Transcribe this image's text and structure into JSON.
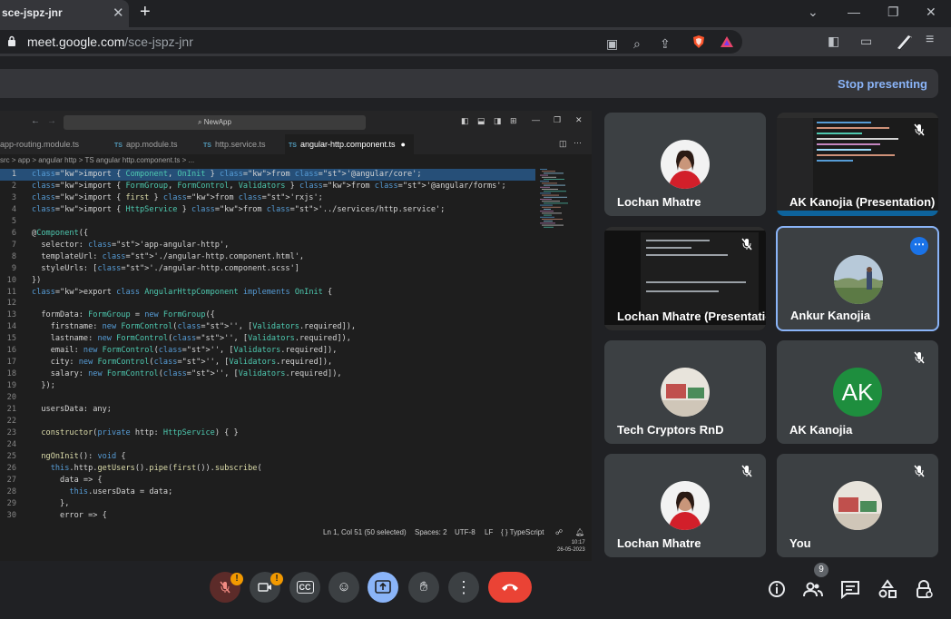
{
  "browser": {
    "tab_title": "sce-jspz-jnr",
    "url_domain": "meet.google.com",
    "url_path": "/sce-jspz-jnr"
  },
  "meet": {
    "stop_presenting": "Stop presenting"
  },
  "vscode": {
    "search_text": "NewApp",
    "tabs": [
      "app-routing.module.ts",
      "app.module.ts",
      "http.service.ts",
      "angular-http.component.ts"
    ],
    "tab_icon": "TS",
    "breadcrumb": "src > app > angular http > TS angular http.component.ts > ...",
    "code_lines": [
      {
        "n": "1",
        "t": "import { Component, OnInit } from '@angular/core';"
      },
      {
        "n": "2",
        "t": "import { FormGroup, FormControl, Validators } from '@angular/forms';"
      },
      {
        "n": "3",
        "t": "import { first } from 'rxjs';"
      },
      {
        "n": "4",
        "t": "import { HttpService } from '../services/http.service';"
      },
      {
        "n": "5",
        "t": ""
      },
      {
        "n": "6",
        "t": "@Component({"
      },
      {
        "n": "7",
        "t": "  selector: 'app-angular-http',"
      },
      {
        "n": "8",
        "t": "  templateUrl: './angular-http.component.html',"
      },
      {
        "n": "9",
        "t": "  styleUrls: ['./angular-http.component.scss']"
      },
      {
        "n": "10",
        "t": "})"
      },
      {
        "n": "11",
        "t": "export class AngularHttpComponent implements OnInit {"
      },
      {
        "n": "12",
        "t": ""
      },
      {
        "n": "13",
        "t": "  formData: FormGroup = new FormGroup({"
      },
      {
        "n": "14",
        "t": "    firstname: new FormControl('', [Validators.required]),"
      },
      {
        "n": "15",
        "t": "    lastname: new FormControl('', [Validators.required]),"
      },
      {
        "n": "16",
        "t": "    email: new FormControl('', [Validators.required]),"
      },
      {
        "n": "17",
        "t": "    city: new FormControl('', [Validators.required]),"
      },
      {
        "n": "18",
        "t": "    salary: new FormControl('', [Validators.required]),"
      },
      {
        "n": "19",
        "t": "  });"
      },
      {
        "n": "20",
        "t": ""
      },
      {
        "n": "21",
        "t": "  usersData: any;"
      },
      {
        "n": "22",
        "t": ""
      },
      {
        "n": "23",
        "t": "  constructor(private http: HttpService) { }"
      },
      {
        "n": "24",
        "t": ""
      },
      {
        "n": "25",
        "t": "  ngOnInit(): void {"
      },
      {
        "n": "26",
        "t": "    this.http.getUsers().pipe(first()).subscribe("
      },
      {
        "n": "27",
        "t": "      data => {"
      },
      {
        "n": "28",
        "t": "        this.usersData = data;"
      },
      {
        "n": "29",
        "t": "      },"
      },
      {
        "n": "30",
        "t": "      error => {"
      }
    ],
    "status": {
      "position": "Ln 1, Col 51 (50 selected)",
      "spaces": "Spaces: 2",
      "encoding": "UTF-8",
      "eol": "LF",
      "language": "{ } TypeScript"
    },
    "clock_time": "10:17",
    "clock_date": "26-05-2023"
  },
  "participants": [
    {
      "name": "Lochan Mhatre",
      "kind": "avatar-photo-red"
    },
    {
      "name": "AK Kanojia (Presentation)",
      "kind": "screen-share",
      "muted": true
    },
    {
      "name": "Lochan Mhatre (Presentation)",
      "kind": "screen-share",
      "muted": true
    },
    {
      "name": "Ankur Kanojia",
      "kind": "avatar-photo-landscape",
      "selected": true
    },
    {
      "name": "Tech Cryptors RnD",
      "kind": "avatar-photo-desk"
    },
    {
      "name": "AK Kanojia",
      "kind": "initials",
      "initials": "AK",
      "muted": true
    },
    {
      "name": "Lochan Mhatre",
      "kind": "avatar-photo-red",
      "muted": true
    },
    {
      "name": "You",
      "kind": "avatar-photo-desk",
      "muted": true
    }
  ],
  "controls": {
    "people_count": "9",
    "warning_badge": "!",
    "captions_label": "CC"
  },
  "colors": {
    "accent_blue": "#8ab4f8",
    "end_call_red": "#ea4335",
    "badge_orange": "#f29900",
    "present_button": "#8ab4f8",
    "ak_avatar_green": "#1e8e3e"
  }
}
